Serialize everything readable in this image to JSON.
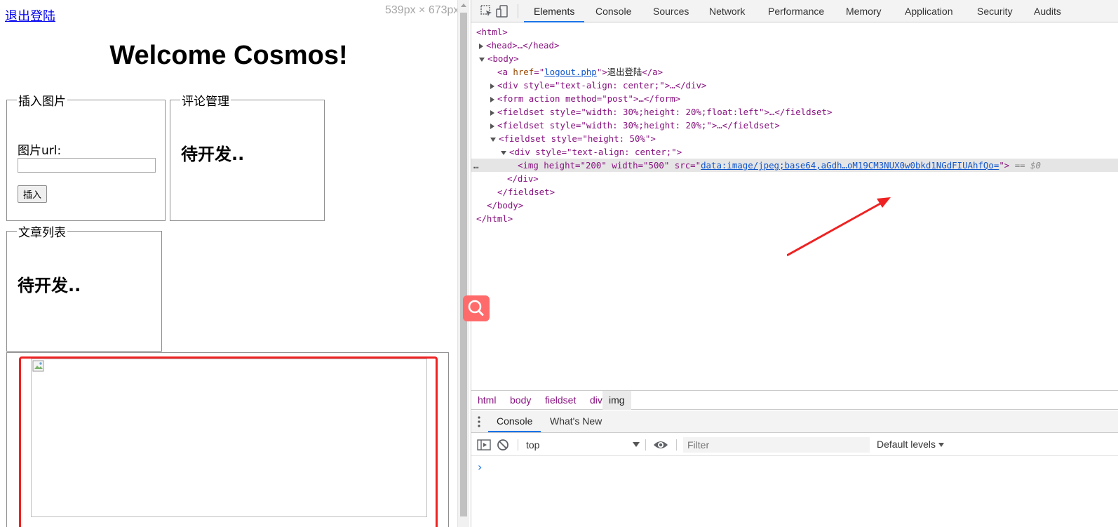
{
  "page": {
    "logout_link": "退出登陆",
    "viewport_dimensions": "539px × 673px",
    "welcome_title": "Welcome Cosmos!",
    "insert_fieldset": {
      "legend": "插入图片",
      "url_label": "图片url:",
      "url_value": "",
      "insert_button": "插入"
    },
    "comment_fieldset": {
      "legend": "评论管理",
      "text": "待开发.."
    },
    "articles_fieldset": {
      "legend": "文章列表",
      "text": "待开发.."
    },
    "image_fieldset": {
      "image_alt": ""
    }
  },
  "devtools": {
    "tabs": [
      "Elements",
      "Console",
      "Sources",
      "Network",
      "Performance",
      "Memory",
      "Application",
      "Security",
      "Audits"
    ],
    "active_tab": "Elements",
    "dom": {
      "html_open": "<html>",
      "head": "<head>…</head>",
      "body_open": "<body>",
      "a_tag_open": "<a ",
      "a_href_name": "href",
      "a_href_value": "logout.php",
      "a_text": "退出登陆",
      "a_close": "</a>",
      "div_center": "<div style=\"text-align: center;\">…</div>",
      "form": "<form action method=\"post\">…</form>",
      "fieldset1": "<fieldset style=\"width: 30%;height: 20%;float:left\">…</fieldset>",
      "fieldset2": "<fieldset style=\"width: 30%;height: 20%;\">…</fieldset>",
      "fieldset3_open": "<fieldset style=\"height: 50%\">",
      "div_open": "<div style=\"text-align: center;\">",
      "img_prefix": "<img height=\"200\" width=\"500\" src=\"",
      "img_src": "data:image/jpeg;base64,aGdh…oM19CM3NUX0w0bkd1NGdFIUAhfQo=",
      "img_suffix": "\">",
      "selected_marker": "== $0",
      "div_close": "</div>",
      "fieldset_close": "</fieldset>",
      "body_close": "</body>",
      "html_close": "</html>"
    },
    "breadcrumbs": [
      "html",
      "body",
      "fieldset",
      "div",
      "img"
    ],
    "active_breadcrumb": "img",
    "drawer_tabs": [
      "Console",
      "What's New"
    ],
    "active_drawer_tab": "Console",
    "console": {
      "context": "top",
      "filter_placeholder": "Filter",
      "levels": "Default levels",
      "prompt": "›"
    }
  },
  "colors": {
    "highlight_border": "#ee2222",
    "arrow": "#ee2222",
    "search_fab": "#ff6b6b",
    "accent_tab": "#1a73e8"
  },
  "icons": [
    "inspect-element-icon",
    "device-toolbar-icon",
    "search-icon",
    "drawer-menu-icon",
    "console-sidebar-icon",
    "clear-console-icon",
    "eye-icon",
    "broken-image-icon"
  ]
}
